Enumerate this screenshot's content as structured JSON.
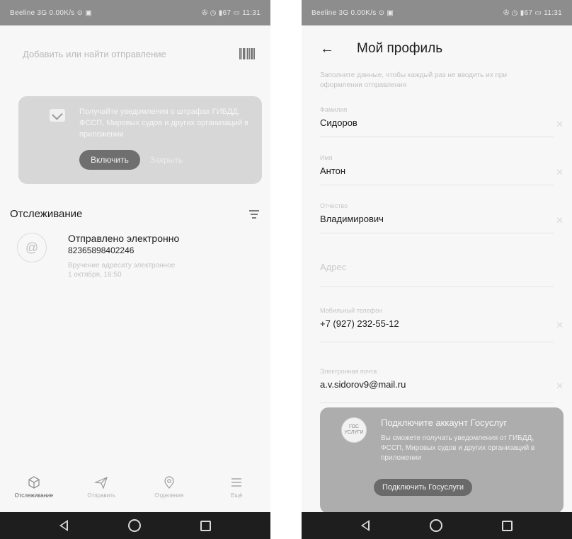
{
  "left_screen": {
    "statusbar": {
      "left": "Beeline 3G 0.00K/s ⊙ ▣",
      "right": "✇ ◷ ▮67 ▭ 11:31"
    },
    "search": {
      "placeholder": "Добавить или найти отправление"
    },
    "promo": {
      "text": "Получайте уведомления о штрафах ГИБДД, ФССП, Мировых судов и других организаций в приложении",
      "enable_label": "Включить",
      "dismiss_label": "Закрыть"
    },
    "tracking": {
      "title": "Отслеживание",
      "item": {
        "title": "Отправлено электронно",
        "number": "82365898402246",
        "subtitle_line1": "Вручение адресату электронное",
        "subtitle_line2": "1 октября, 16:50"
      }
    },
    "tabbar": [
      {
        "label": "Отслеживание",
        "icon": "box-icon"
      },
      {
        "label": "Отправить",
        "icon": "send-icon"
      },
      {
        "label": "Отделения",
        "icon": "location-pin-icon"
      },
      {
        "label": "Ещё",
        "icon": "menu-icon"
      }
    ]
  },
  "right_screen": {
    "statusbar": {
      "left": "Beeline 3G 0.00K/s ⊙ ▣",
      "right": "✇ ◷ ▮67 ▭ 11:31"
    },
    "header": {
      "title": "Мой профиль"
    },
    "intro": "Заполните данные, чтобы каждый раз не вводить их при оформлении отправления",
    "fields": {
      "surname": {
        "label": "Фамилия",
        "value": "Сидоров"
      },
      "name": {
        "label": "Имя",
        "value": "Антон"
      },
      "patronymic": {
        "label": "Отчество",
        "value": "Владимирович"
      },
      "address": {
        "placeholder": "Адрес"
      },
      "phone": {
        "label": "Мобильный телефон",
        "value": "+7 (927) 232-55-12"
      },
      "email": {
        "label": "Электронная почта",
        "value": "a.v.sidorov9@mail.ru"
      }
    },
    "gosuslugi": {
      "logo_text": "ГОС УСЛУГИ",
      "title": "Подключите аккаунт Госуслуг",
      "text": "Вы сможете получать уведомления от ГИБДД, ФССП, Мировых судов и других организаций в приложении",
      "button_label": "Подключить Госуслуги"
    }
  }
}
